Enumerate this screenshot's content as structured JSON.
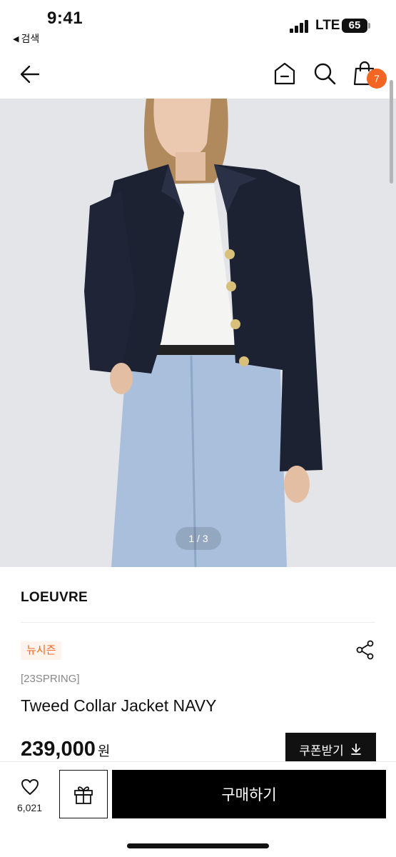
{
  "status_bar": {
    "time": "9:41",
    "back_app_label": "검색",
    "network": "LTE",
    "battery": "65"
  },
  "header": {
    "icons": [
      "arrow-left-icon",
      "home-icon",
      "search-icon",
      "shopping-bag-icon"
    ],
    "cart_count": "7"
  },
  "gallery": {
    "pager": "1 / 3",
    "current": 1,
    "total": 3
  },
  "product": {
    "brand": "LOEUVRE",
    "badge": "뉴시즌",
    "season_code": "[23SPRING]",
    "name": "Tweed Collar Jacket NAVY",
    "price": "239,000",
    "currency": "원",
    "coupon_label": "쿠폰받기"
  },
  "bottom_bar": {
    "like_count": "6,021",
    "buy_label": "구매하기"
  },
  "colors": {
    "accent": "#f26522",
    "badge_bg": "#fff3ed",
    "primary_button": "#000000",
    "image_bg": "#e4e5e9",
    "jacket_navy": "#1d2233",
    "denim": "#a9bfdc"
  }
}
